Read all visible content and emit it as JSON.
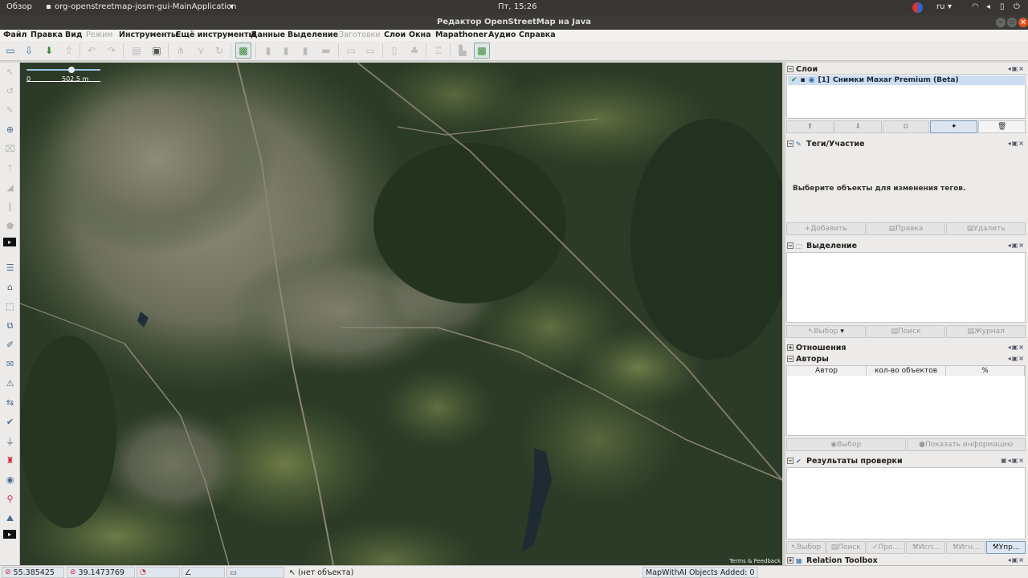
{
  "system": {
    "activities": "Обзор",
    "app_menu": "org-openstreetmap-josm-gui-MainApplication",
    "clock": "Пт, 15:26",
    "lang": "ru",
    "chevron": "▾"
  },
  "window": {
    "title": "Редактор OpenStreetMap на Java"
  },
  "menu": {
    "file": "Файл",
    "edit": "Правка",
    "view": "Вид",
    "mode": "Режим",
    "tools": "Инструменты",
    "more_tools": "Ещё инструменты",
    "data": "Данные",
    "selection": "Выделение",
    "presets": "Заготовки",
    "layers": "Слои",
    "windows": "Окна",
    "mapathoner": "Mapathoner",
    "audio": "Аудио",
    "help": "Справка"
  },
  "map": {
    "scale_zero": "0",
    "scale_label": "502,5 m",
    "terms": "Terms & Feedback"
  },
  "layers_panel": {
    "title": "Слои",
    "layer": {
      "index": "[1]",
      "name": "Снимки Maxar Premium (Beta)"
    }
  },
  "tags_panel": {
    "title": "Теги/Участие",
    "message": "Выберите объекты для изменения тегов.",
    "add": "Добавить",
    "edit": "Правка",
    "delete": "Удалить"
  },
  "selection_panel": {
    "title": "Выделение",
    "select": "Выбор",
    "search": "Поиск",
    "history": "Журнал"
  },
  "relations_panel": {
    "title": "Отношения"
  },
  "authors_panel": {
    "title": "Авторы",
    "col_author": "Автор",
    "col_count": "кол-во объектов",
    "col_percent": "%",
    "select": "Выбор",
    "show_info": "Показать информацию"
  },
  "validation_panel": {
    "title": "Результаты проверки",
    "select": "Выбор",
    "search": "Поиск",
    "fix": "Про...",
    "fix2": "Исп...",
    "ignore": "Игн...",
    "manage": "Упр..."
  },
  "relation_toolbox": {
    "title": "Relation Toolbox"
  },
  "status": {
    "lat": "55.385425",
    "lon": "39.1473769",
    "selection": "(нет объекта)",
    "mapwithai": "MapWithAI Objects Added: 0"
  }
}
